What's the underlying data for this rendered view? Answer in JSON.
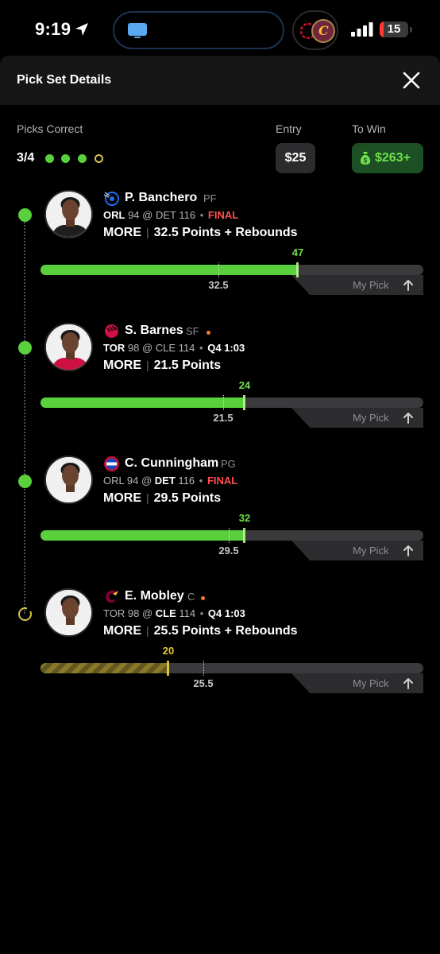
{
  "status_bar": {
    "time": "9:19",
    "battery_level": "15",
    "battery_fraction": 0.15,
    "icons": [
      "location-arrow-icon",
      "tv-icon",
      "raptors-logo-icon",
      "cavaliers-logo-icon",
      "signal-icon",
      "battery-icon"
    ]
  },
  "sheet": {
    "title": "Pick Set Details",
    "close_icon": "close-icon"
  },
  "summary": {
    "picks_correct_label": "Picks Correct",
    "picks_correct_value": "3/4",
    "progress_dots": [
      "done",
      "done",
      "done",
      "pending"
    ],
    "entry_label": "Entry",
    "entry_value": "$25",
    "to_win_label": "To Win",
    "to_win_value": "$263+",
    "to_win_icon": "money-bag-icon"
  },
  "colors": {
    "hit_green": "#5ad13c",
    "pending_gold": "#d6c24a",
    "final_red": "#ff4f4f",
    "live_orange": "#ef7d32",
    "to_win_bg": "#1c4f24"
  },
  "picks": [
    {
      "team_logo": "magic-logo-icon",
      "name": "P. Banchero",
      "position": "PF",
      "live": false,
      "status": "done",
      "away_team": "ORL",
      "away_score": "94",
      "at": "@",
      "home_team": "DET",
      "home_score": "116",
      "state": "FINAL",
      "bold_team": "away",
      "direction": "MORE",
      "line": "32.5",
      "stat": "Points + Rebounds",
      "actual": "47",
      "actual_num": 47,
      "line_num": 32.5,
      "my_pick_label": "My Pick"
    },
    {
      "team_logo": "raptors-logo-icon",
      "name": "S. Barnes",
      "position": "SF",
      "live": true,
      "status": "done",
      "away_team": "TOR",
      "away_score": "98",
      "at": "@",
      "home_team": "CLE",
      "home_score": "114",
      "state": "Q4 1:03",
      "bold_team": "away",
      "direction": "MORE",
      "line": "21.5",
      "stat": "Points",
      "actual": "24",
      "actual_num": 24,
      "line_num": 21.5,
      "my_pick_label": "My Pick"
    },
    {
      "team_logo": "pistons-logo-icon",
      "name": "C. Cunningham",
      "position": "PG",
      "live": false,
      "status": "done",
      "away_team": "ORL",
      "away_score": "94",
      "at": "@",
      "home_team": "DET",
      "home_score": "116",
      "state": "FINAL",
      "bold_team": "home",
      "direction": "MORE",
      "line": "29.5",
      "stat": "Points",
      "actual": "32",
      "actual_num": 32,
      "line_num": 29.5,
      "my_pick_label": "My Pick"
    },
    {
      "team_logo": "cavaliers-logo-icon",
      "name": "E. Mobley",
      "position": "C",
      "live": true,
      "status": "pending",
      "away_team": "TOR",
      "away_score": "98",
      "at": "@",
      "home_team": "CLE",
      "home_score": "114",
      "state": "Q4 1:03",
      "bold_team": "home",
      "direction": "MORE",
      "line": "25.5",
      "stat": "Points + Rebounds",
      "actual": "20",
      "actual_num": 20,
      "line_num": 25.5,
      "my_pick_label": "My Pick"
    }
  ]
}
